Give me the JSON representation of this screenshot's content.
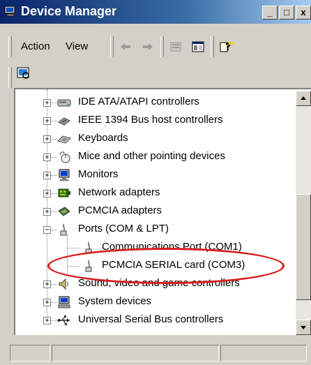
{
  "window": {
    "title": "Device Manager",
    "buttons": {
      "minimize": "_",
      "maximize": "□",
      "close": "x"
    }
  },
  "menu": {
    "items": [
      "Action",
      "View"
    ]
  },
  "toolbar": {
    "icons": [
      "back-arrow-icon",
      "forward-arrow-icon",
      "properties-icon",
      "view-toggle-icon",
      "help-icon"
    ]
  },
  "toolbar2": {
    "icons": [
      "scan-hardware-icon"
    ]
  },
  "tree": {
    "items": [
      {
        "label": "IDE ATA/ATAPI controllers",
        "expander": "+",
        "icon": "ide-controller-icon",
        "level": 0
      },
      {
        "label": "IEEE 1394 Bus host controllers",
        "expander": "+",
        "icon": "ieee1394-icon",
        "level": 0
      },
      {
        "label": "Keyboards",
        "expander": "+",
        "icon": "keyboard-icon",
        "level": 0
      },
      {
        "label": "Mice and other pointing devices",
        "expander": "+",
        "icon": "mouse-icon",
        "level": 0
      },
      {
        "label": "Monitors",
        "expander": "+",
        "icon": "monitor-icon",
        "level": 0
      },
      {
        "label": "Network adapters",
        "expander": "+",
        "icon": "network-adapter-icon",
        "level": 0
      },
      {
        "label": "PCMCIA adapters",
        "expander": "+",
        "icon": "pcmcia-adapter-icon",
        "level": 0
      },
      {
        "label": "Ports (COM & LPT)",
        "expander": "−",
        "icon": "port-icon",
        "level": 0
      },
      {
        "label": "Communications Port (COM1)",
        "expander": "",
        "icon": "port-icon",
        "level": 1
      },
      {
        "label": "PCMCIA SERIAL card (COM3)",
        "expander": "",
        "icon": "port-icon",
        "level": 1
      },
      {
        "label": "Sound, video and game controllers",
        "expander": "+",
        "icon": "speaker-icon",
        "level": 0
      },
      {
        "label": "System devices",
        "expander": "+",
        "icon": "computer-icon",
        "level": 0
      },
      {
        "label": "Universal Serial Bus controllers",
        "expander": "+",
        "icon": "usb-icon",
        "level": 0
      }
    ]
  },
  "colors": {
    "title_start": "#0a246a",
    "title_end": "#a6caf0",
    "chrome": "#d4d0c8",
    "highlight_circle": "#d81e1e"
  }
}
